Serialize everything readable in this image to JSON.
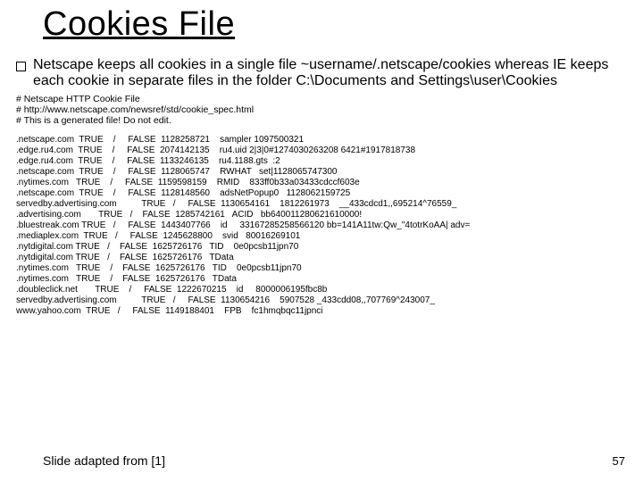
{
  "title": "Cookies File",
  "bullet": "Netscape keeps all cookies in a single file ~username/.netscape/cookies whereas IE keeps each cookie in separate files in the folder C:\\Documents and Settings\\user\\Cookies",
  "comments": [
    "# Netscape HTTP Cookie File",
    "# http://www.netscape.com/newsref/std/cookie_spec.html",
    "# This is a generated file! Do not edit."
  ],
  "cookies": [
    ".netscape.com  TRUE    /     FALSE  1128258721    sampler 1097500321",
    ".edge.ru4.com  TRUE    /     FALSE  2074142135    ru4.uid 2|3|0#1274030263208 6421#1917818738",
    ".edge.ru4.com  TRUE    /     FALSE  1133246135    ru4.1188.gts  :2",
    ".netscape.com  TRUE    /     FALSE  1128065747    RWHAT   set|1128065747300",
    ".nytimes.com   TRUE    /     FALSE  1159598159    RMID    833ff0b33a03433cdccf603e",
    ".netscape.com  TRUE    /     FALSE  1128148560    adsNetPopup0   1128062159725",
    "servedby.advertising.com          TRUE   /     FALSE  1130654161    1812261973    __433cdcd1,,695214^76559_",
    ".advertising.com       TRUE   /    FALSE  1285742161   ACID   bb640011280621610000!",
    ".bluestreak.com TRUE   /     FALSE  1443407766    id     33167285258566120 bb=141A11tw:Qw_\"4totrKoAA| adv=",
    ".mediaplex.com  TRUE   /     FALSE  1245628800    svid   80016269101",
    ".nytdigital.com TRUE   /    FALSE  1625726176   TID    0e0pcsb11jpn70",
    ".nytdigital.com TRUE   /    FALSE  1625726176   TData",
    ".nytimes.com   TRUE    /    FALSE  1625726176   TID    0e0pcsb11jpn70",
    ".nytimes.com   TRUE    /    FALSE  1625726176   TData",
    ".doubleclick.net       TRUE    /     FALSE  1222670215    id     8000006195fbc8b",
    "servedby.advertising.com          TRUE   /     FALSE  1130654216    5907528 _433cdd08,,707769^243007_",
    "www.yahoo.com  TRUE   /     FALSE  1149188401    FPB    fc1hmqbqc11jpnci"
  ],
  "footer_left": "Slide adapted from [1]",
  "footer_right": "57"
}
